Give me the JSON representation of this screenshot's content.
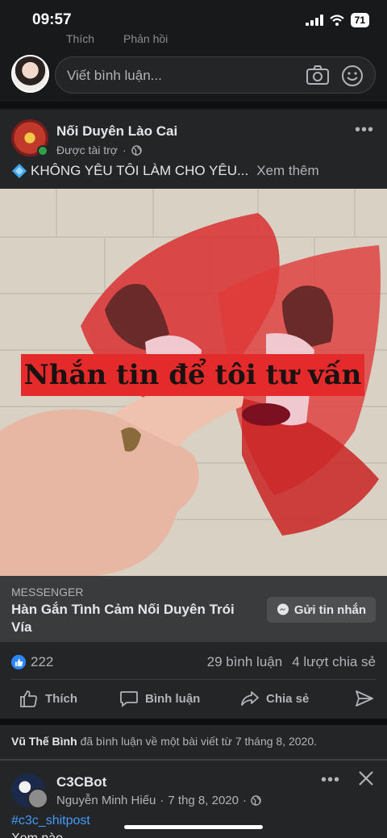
{
  "status_bar": {
    "time": "09:57",
    "battery": "71"
  },
  "previous_comment_actions": {
    "like": "Thích",
    "reply": "Phản hồi"
  },
  "comment_bar": {
    "placeholder": "Viết bình luận..."
  },
  "sponsored_post": {
    "page_name": "Nối Duyên Lào Cai",
    "sponsored_label": "Được tài trợ",
    "text": "KHÔNG YÊU TÔI LÀM CHO YÊU...",
    "see_more": "Xem thêm",
    "image_banner": "Nhắn tin để tôi tư vấn",
    "cta": {
      "label": "MESSENGER",
      "title": "Hàn Gắn Tình Cảm Nối Duyên Trói Vía",
      "button": "Gửi tin nhắn"
    },
    "reactions_count": "222",
    "comments_count": "29 bình luận",
    "shares_count": "4 lượt chia sẻ",
    "actions": {
      "like": "Thích",
      "comment": "Bình luận",
      "share": "Chia sẻ"
    }
  },
  "activity_notice": {
    "user": "Vũ Thế Bình",
    "text": "đã bình luận về một bài viết từ 7 tháng 8, 2020."
  },
  "second_post": {
    "group_name": "C3CBot",
    "author": "Nguyễn Minh Hiếu",
    "date": "7 thg 8, 2020",
    "hashtag": "#c3c_shitpost",
    "text": "Xem nào"
  },
  "colors": {
    "background": "#18191a",
    "card": "#242526",
    "accent_blue": "#2d88ff",
    "banner_red": "#e42a2a"
  }
}
